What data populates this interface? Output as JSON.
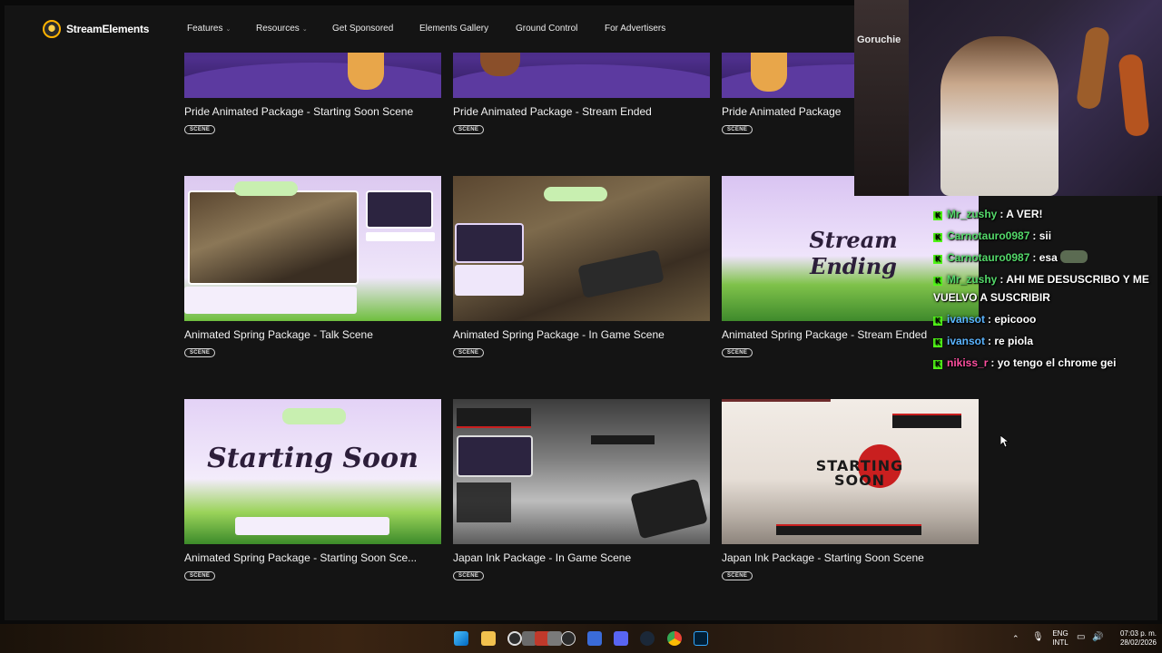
{
  "brand": {
    "name": "StreamElements"
  },
  "nav": {
    "items": [
      {
        "label": "Features",
        "has_caret": true
      },
      {
        "label": "Resources",
        "has_caret": true
      },
      {
        "label": "Get Sponsored",
        "has_caret": false
      },
      {
        "label": "Elements Gallery",
        "has_caret": false
      },
      {
        "label": "Ground Control",
        "has_caret": false
      },
      {
        "label": "For Advertisers",
        "has_caret": false
      }
    ]
  },
  "cards": [
    {
      "title": "Pride Animated Package - Starting Soon Scene",
      "badge": "SCENE"
    },
    {
      "title": "Pride Animated Package - Stream Ended",
      "badge": "SCENE"
    },
    {
      "title": "Pride Animated Package",
      "badge": "SCENE"
    },
    {
      "title": "Animated Spring Package - Talk Scene",
      "badge": "SCENE"
    },
    {
      "title": "Animated Spring Package - In Game Scene",
      "badge": "SCENE"
    },
    {
      "title": "Animated Spring Package - Stream Ended",
      "badge": "SCENE",
      "thumb_text": "Stream Ending"
    },
    {
      "title": "Animated Spring Package - Starting Soon Sce...",
      "badge": "SCENE",
      "thumb_text": "Starting Soon"
    },
    {
      "title": "Japan Ink Package - In Game Scene",
      "badge": "SCENE"
    },
    {
      "title": "Japan Ink Package - Starting Soon Scene",
      "badge": "SCENE",
      "thumb_text": "STARTING SOON"
    }
  ],
  "webcam": {
    "shelf_label": "Goruchie"
  },
  "chat": [
    {
      "user": "Mr_zushy",
      "color": "#54d96a",
      "text": "A VER!"
    },
    {
      "user": "Carnotauro0987",
      "color": "#54d96a",
      "text": "sii"
    },
    {
      "user": "Carnotauro0987",
      "color": "#54d96a",
      "text": "esa",
      "emote": true
    },
    {
      "user": "Mr_zushy",
      "color": "#54d96a",
      "text": "AHI ME DESUSCRIBO Y ME VUELVO A SUSCRIBIR"
    },
    {
      "user": "ivansot",
      "color": "#5ab4ff",
      "text": "epicooo"
    },
    {
      "user": "ivansot",
      "color": "#5ab4ff",
      "text": "re piola"
    },
    {
      "user": "nikiss_r",
      "color": "#ff4fa0",
      "text": "yo tengo el chrome gei"
    }
  ],
  "taskbar": {
    "lang_top": "ENG",
    "lang_bottom": "INTL",
    "time": "07:03 p. m.",
    "date": "28/02/2026",
    "icons": [
      "windows-icon",
      "file-explorer-icon",
      "obs-icon",
      "app-icon",
      "voicemod-icon",
      "app-icon",
      "github-icon",
      "shield-icon",
      "discord-icon",
      "steam-icon",
      "chrome-icon",
      "photoshop-icon"
    ]
  }
}
